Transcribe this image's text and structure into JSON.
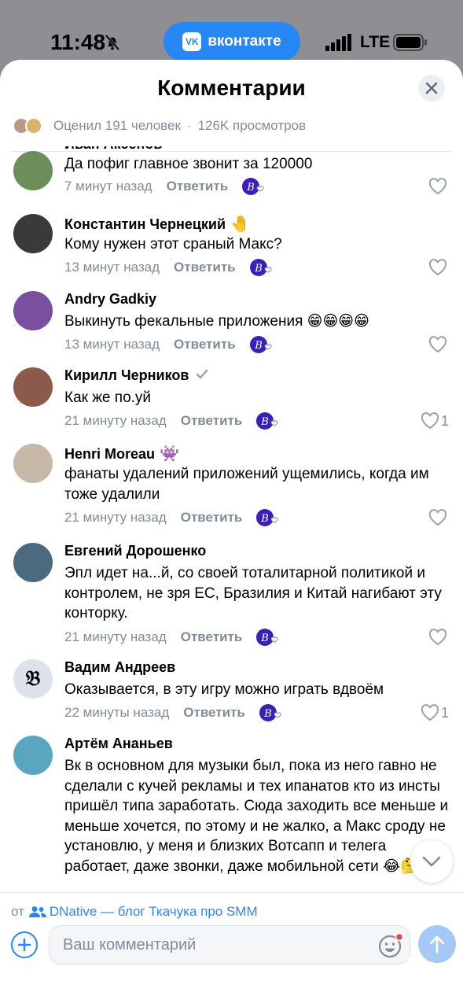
{
  "status_bar": {
    "time": "11:48",
    "network": "LTE"
  },
  "app_pill": {
    "label": "вконтакте",
    "logo": "VK"
  },
  "header": {
    "title": "Комментарии"
  },
  "stats": {
    "rated": "Оценил 191 человек",
    "separator": "·",
    "views": "126K просмотров"
  },
  "comments": [
    {
      "author": "Иван Аксенов",
      "emoji": "",
      "text": "Да пофиг главное звонит за 120000",
      "time": "7 минут назад",
      "reply": "Ответить",
      "likes": "",
      "avatar_color": "#6b8e5a"
    },
    {
      "author": "Константин Чернецкий",
      "emoji": "🤚",
      "text": "Кому нужен этот сраный Макс?",
      "time": "13 минут назад",
      "reply": "Ответить",
      "likes": "",
      "avatar_color": "#3a3a3a"
    },
    {
      "author": "Andry Gadkiy",
      "emoji": "",
      "text": "Выкинуть фекальные приложения 😁😁😁😁",
      "time": "13 минут назад",
      "reply": "Ответить",
      "likes": "",
      "avatar_color": "#7a4fa0"
    },
    {
      "author": "Кирилл Черников",
      "emoji": "",
      "verified": true,
      "text": "Как же по.уй",
      "time": "21 минуту назад",
      "reply": "Ответить",
      "likes": "1",
      "avatar_color": "#8b5a4a"
    },
    {
      "author": "Henri Moreau",
      "emoji": "👾",
      "text": "фанаты удалений приложений ущемились, когда им тоже удалили",
      "time": "21 минуту назад",
      "reply": "Ответить",
      "likes": "",
      "avatar_color": "#c7b8a8"
    },
    {
      "author": "Евгений Дорошенко",
      "emoji": "",
      "text": "Эпл идет на...й, со своей тоталитарной политикой и контролем, не зря ЕС, Бразилия и Китай нагибают эту конторку.",
      "time": "21 минуту назад",
      "reply": "Ответить",
      "likes": "",
      "avatar_color": "#4a6a80"
    },
    {
      "author": "Вадим Андреев",
      "emoji": "",
      "text": "Оказывается, в эту игру можно играть вдвоём",
      "time": "22 минуты назад",
      "reply": "Ответить",
      "likes": "1",
      "avatar_color": "#dde3ea"
    },
    {
      "author": "Артём Ананьев",
      "emoji": "",
      "text": "Вк в основном для музыки был, пока из него гавно не сделали с кучей рекламы и тех ипанатов кто из инсты пришёл типа заработать. Сюда заходить все меньше и меньше хочется,  по этому и не жалко, а Макс сроду не установлю, у меня и близких Вотсапп и телега работает, даже звонки, даже мобильной сети 😂🤔",
      "time": "",
      "reply": "",
      "likes": "",
      "avatar_color": "#5aa6c0"
    }
  ],
  "from_bar": {
    "prefix": "от",
    "community": "DNative — блог Ткачука про SMM"
  },
  "composer": {
    "placeholder": "Ваш комментарий"
  },
  "colors": {
    "accent": "#2787f5",
    "secondary_text": "#818c99"
  }
}
